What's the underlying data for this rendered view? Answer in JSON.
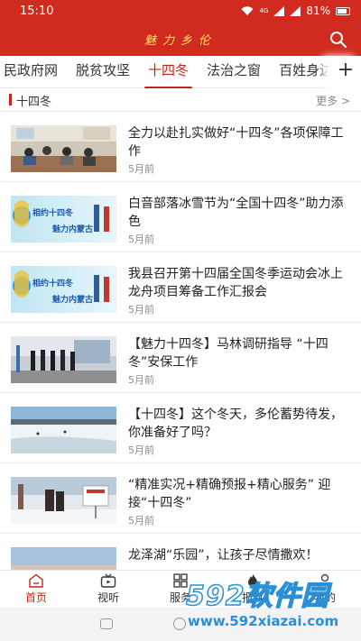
{
  "status_bar": {
    "time": "15:10",
    "network": "4G",
    "battery": "81%"
  },
  "header": {
    "title": "魅力乡伦",
    "search_icon": "search-icon",
    "colors": {
      "bar": "#d12a1e",
      "title": "#ffe16a"
    }
  },
  "tabs": [
    {
      "label": "民政府网"
    },
    {
      "label": "脱贫攻坚"
    },
    {
      "label": "十四冬"
    },
    {
      "label": "法治之窗"
    },
    {
      "label": "百姓身边"
    }
  ],
  "tabs_add_label": "+",
  "section": {
    "title": "十四冬",
    "more": "更多 >"
  },
  "news": [
    {
      "title": "全力以赴扎实做好“十四冬”各项保障工作",
      "time": "5月前",
      "thumb": "meeting-room-photo"
    },
    {
      "title": "白音部落冰雪节为“全国十四冬”助力添色",
      "time": "5月前",
      "thumb": "winter-games-banner"
    },
    {
      "title": "我县召开第十四届全国冬季运动会冰上龙舟项目筹备工作汇报会",
      "time": "5月前",
      "thumb": "winter-games-banner"
    },
    {
      "title": "【魅力十四冬】马林调研指导 “十四冬”安保工作",
      "time": "5月前",
      "thumb": "inspection-photo"
    },
    {
      "title": "【十四冬】这个冬天，多伦蓄势待发，你准备好了吗？",
      "time": "5月前",
      "thumb": "frozen-lake-photo"
    },
    {
      "title": "“精准实况+精确预报+精心服务” 迎接“十四冬”",
      "time": "5月前",
      "thumb": "weather-station-photo"
    },
    {
      "title": "龙泽湖“乐园”，让孩子尽情撒欢！",
      "time": "",
      "thumb": "lake-photo"
    }
  ],
  "banner_text": {
    "line1": "相约十四冬",
    "line2": "魅力内蒙古"
  },
  "bottom_nav": [
    {
      "label": "首页",
      "icon": "home-icon"
    },
    {
      "label": "视听",
      "icon": "tv-icon"
    },
    {
      "label": "服务",
      "icon": "grid-icon"
    },
    {
      "label": "报料",
      "icon": "flame-icon"
    },
    {
      "label": "我的",
      "icon": "user-icon"
    }
  ],
  "watermark": {
    "main": "592软件园",
    "url": "www.592xiazai.com"
  }
}
